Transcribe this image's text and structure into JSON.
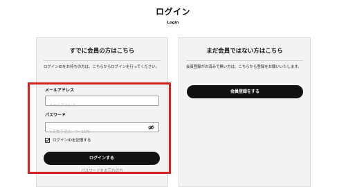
{
  "header": {
    "title": "ログイン",
    "subtitle": "Login"
  },
  "member_panel": {
    "heading": "すでに会員の方はこちら",
    "description": "ログインIDをお持ちの方は、こちらからログインを行ってください。",
    "email_label": "メールアドレス",
    "email_placeholder": "メールアドレス",
    "email_value": "",
    "password_label": "パスワード",
    "password_placeholder": "※英数字混合、7〜16桁",
    "password_value": "",
    "password_toggle_icon": "eye-slash-icon",
    "remember_label": "ログインIDを記憶する",
    "remember_checked": true,
    "login_button": "ログインする",
    "forgot_link": "パスワードをお忘れの方"
  },
  "guest_panel": {
    "heading": "まだ会員ではない方はこちら",
    "description": "会員登録がお済みで無い方は、こちらから登録をお願いいたします。",
    "register_button": "会員登録をする"
  },
  "annotation": {
    "highlight_color": "#d6201f"
  }
}
